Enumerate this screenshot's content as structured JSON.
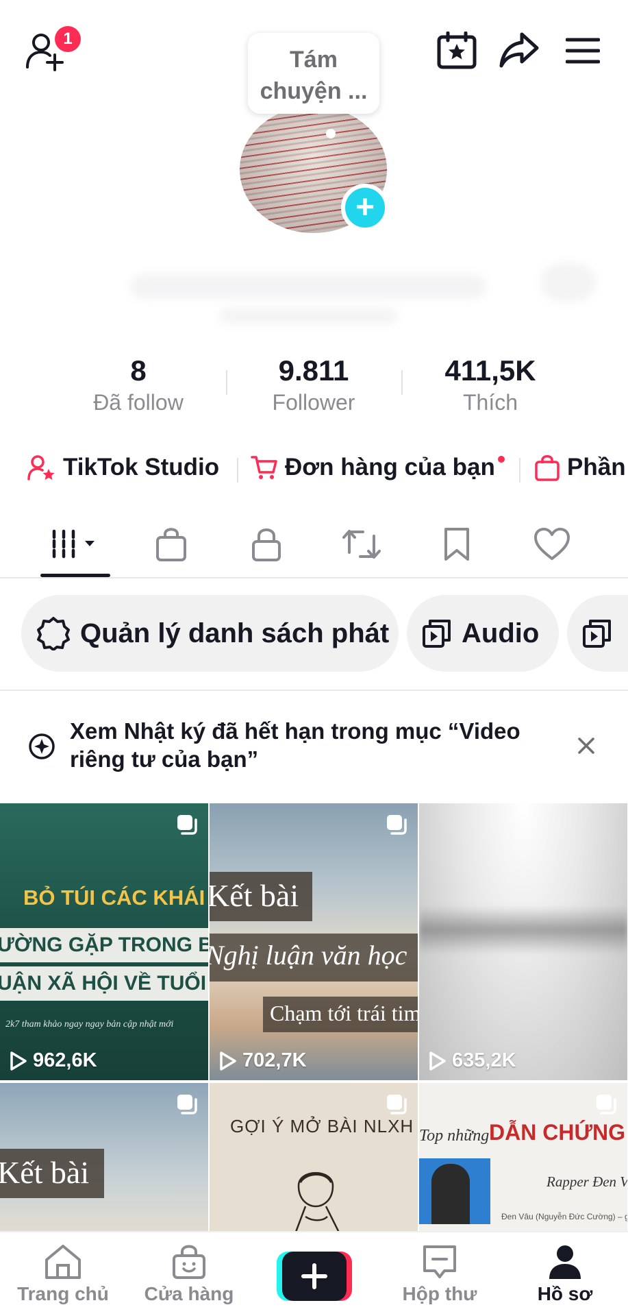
{
  "header": {
    "friend_badge": "1",
    "note_line1": "Tám",
    "note_line2": "chuyện ..."
  },
  "stats": [
    {
      "value": "8",
      "label": "Đã follow"
    },
    {
      "value": "9.811",
      "label": "Follower"
    },
    {
      "value": "411,5K",
      "label": "Thích"
    }
  ],
  "quick_links": [
    {
      "label": "TikTok Studio",
      "icon": "user-star-icon"
    },
    {
      "label": "Đơn hàng của bạn",
      "icon": "cart-icon"
    },
    {
      "label": "Phần",
      "icon": "shopping-bag-icon"
    }
  ],
  "tabs": [
    {
      "icon": "grid-icon",
      "active": true
    },
    {
      "icon": "shopping-bag-icon"
    },
    {
      "icon": "lock-icon"
    },
    {
      "icon": "repost-icon"
    },
    {
      "icon": "bookmark-icon"
    },
    {
      "icon": "heart-icon"
    }
  ],
  "chips": [
    {
      "label": "Quản lý danh sách phát",
      "icon": "gear-icon"
    },
    {
      "label": "Audio",
      "icon": "playlist-icon"
    },
    {
      "label": "",
      "icon": "playlist-icon"
    }
  ],
  "notice": {
    "text": "Xem Nhật ký đã hết hạn trong mục “Video riêng tư của bạn”"
  },
  "videos": [
    {
      "views": "962,6K",
      "lines": [
        "BỎ TÚI CÁC KHÁI NIỆM",
        "ƯỜNG GẶP TRONG BÀI N",
        "UẬN XÃ HỘI VỀ TUỔI TR",
        "2k7 tham khảo ngay ngay bản cập nhật mới"
      ]
    },
    {
      "views": "702,7K",
      "lines": [
        "Kết bài",
        "Nghị luận văn học",
        "Chạm tới trái tim"
      ]
    },
    {
      "views": "635,2K",
      "lines": []
    },
    {
      "views": "",
      "lines": [
        "Kết bài"
      ]
    },
    {
      "views": "",
      "lines": [
        "GỢI Ý MỞ BÀI NLXH"
      ]
    },
    {
      "views": "",
      "lines": [
        "Top những",
        "DẪN CHỨNG \"ẤN Đ",
        "Rapper Đen Vâu",
        "Đen Vâu (Nguyễn Đức Cường) – gươ"
      ]
    }
  ],
  "bottom_nav": [
    {
      "label": "Trang chủ",
      "icon": "home-icon"
    },
    {
      "label": "Cửa hàng",
      "icon": "shop-icon"
    },
    {
      "label": "",
      "icon": "create-icon"
    },
    {
      "label": "Hộp thư",
      "icon": "inbox-icon"
    },
    {
      "label": "Hồ sơ",
      "icon": "profile-icon",
      "active": true
    }
  ],
  "colors": {
    "accent": "#fe2c55",
    "cyan": "#20d5ec",
    "text": "#161823",
    "muted": "#8a8b91"
  }
}
